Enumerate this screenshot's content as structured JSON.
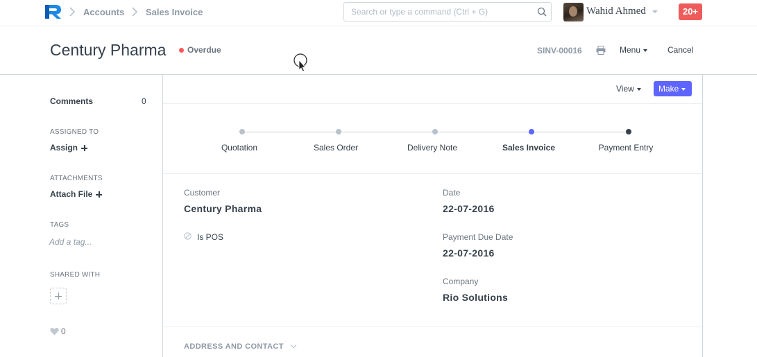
{
  "navbar": {
    "breadcrumbs": [
      "Accounts",
      "Sales Invoice"
    ],
    "search_placeholder": "Search or type a command (Ctrl + G)",
    "user_name": "Wahid Ahmed",
    "notification_count": "20+",
    "brand_color": "#1e88e5"
  },
  "page": {
    "title": "Century Pharma",
    "status": "Overdue",
    "status_color": "#ff5858",
    "doc_name": "SINV-00016",
    "menu_label": "Menu",
    "cancel_label": "Cancel"
  },
  "sidebar": {
    "comments_label": "Comments",
    "comments_count": "0",
    "assigned_label": "ASSIGNED TO",
    "assign_link": "Assign",
    "attachments_label": "ATTACHMENTS",
    "attach_link": "Attach File",
    "tags_label": "TAGS",
    "tag_placeholder": "Add a tag...",
    "shared_label": "SHARED WITH",
    "likes_count": "0"
  },
  "toolbar": {
    "view_label": "View",
    "make_label": "Make",
    "make_color": "#5e64ff"
  },
  "flow": {
    "steps": [
      {
        "label": "Quotation",
        "state": "done"
      },
      {
        "label": "Sales Order",
        "state": "done"
      },
      {
        "label": "Delivery Note",
        "state": "done"
      },
      {
        "label": "Sales Invoice",
        "state": "current"
      },
      {
        "label": "Payment Entry",
        "state": "next"
      }
    ]
  },
  "fields": {
    "customer_label": "Customer",
    "customer_value": "Century Pharma",
    "is_pos_label": "Is POS",
    "date_label": "Date",
    "date_value": "22-07-2016",
    "due_label": "Payment Due Date",
    "due_value": "22-07-2016",
    "company_label": "Company",
    "company_value": "Rio Solutions"
  },
  "sections": {
    "address_contact": "ADDRESS AND CONTACT"
  }
}
